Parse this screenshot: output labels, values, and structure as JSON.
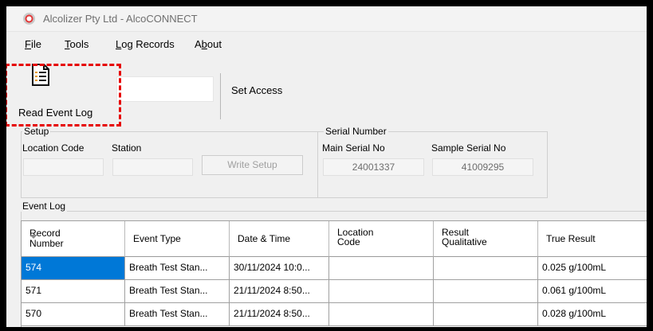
{
  "window": {
    "title": "Alcolizer Pty Ltd  -  AlcoCONNECT"
  },
  "menu": [
    {
      "pre": "",
      "u": "F",
      "post": "ile"
    },
    {
      "pre": "",
      "u": "T",
      "post": "ools"
    },
    {
      "pre": "",
      "u": "L",
      "post": "og Records"
    },
    {
      "pre": "A",
      "u": "b",
      "post": "out"
    }
  ],
  "toolbar": {
    "read_event_log": "Read Event Log",
    "access_value": "",
    "set_access": "Set Access"
  },
  "setup": {
    "title": "Setup",
    "location_code_label": "Location Code",
    "station_label": "Station",
    "location_code_value": "",
    "station_value": "",
    "write_setup": "Write Setup"
  },
  "serial": {
    "title": "Serial Number",
    "main_label": "Main Serial No",
    "sample_label": "Sample Serial No",
    "main_value": "24001337",
    "sample_value": "41009295"
  },
  "event_log": {
    "title": "Event Log",
    "columns": [
      [
        "Record",
        "Number"
      ],
      [
        "Event Type"
      ],
      [
        "Date & Time"
      ],
      [
        "Location",
        "Code"
      ],
      [
        "Result",
        "Qualitative"
      ],
      [
        "True Result"
      ]
    ],
    "rows": [
      [
        "574",
        "Breath Test Stan...",
        "30/11/2024 10:0...",
        "",
        "",
        "0.025 g/100mL"
      ],
      [
        "571",
        "Breath Test Stan...",
        "21/11/2024 8:50...",
        "",
        "",
        "0.061 g/100mL"
      ],
      [
        "570",
        "Breath Test Stan...",
        "21/11/2024 8:50...",
        "",
        "",
        "0.028 g/100mL"
      ]
    ],
    "selected_row": 0
  }
}
